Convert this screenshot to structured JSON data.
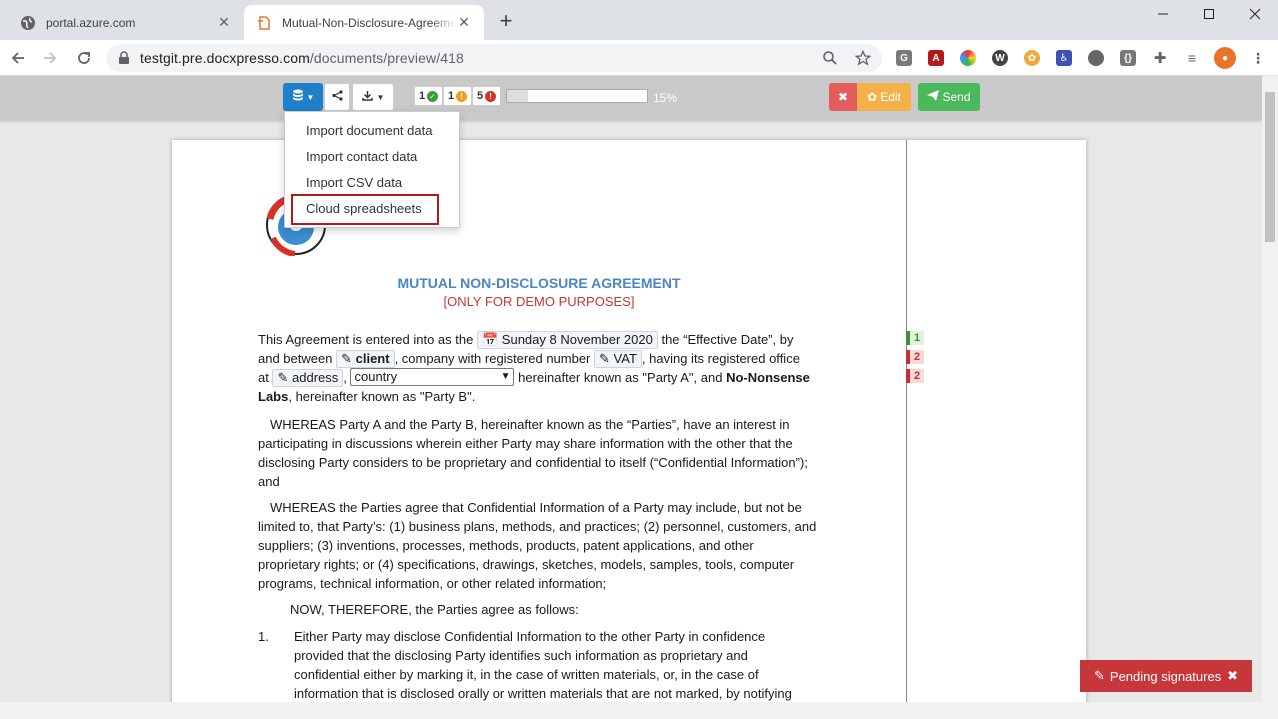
{
  "browser": {
    "tabs": [
      {
        "title": "portal.azure.com",
        "active": false
      },
      {
        "title": "Mutual-Non-Disclosure-Agreeme",
        "active": true
      }
    ],
    "url_host": "testgit.pre.docxpresso.com",
    "url_path": "/documents/preview/418",
    "new_tab": "+"
  },
  "appbar": {
    "counters": [
      {
        "value": "1",
        "color": "#3a9a3a",
        "icon": "check-icon"
      },
      {
        "value": "1",
        "color": "#f0a020",
        "icon": "warning-icon"
      },
      {
        "value": "5",
        "color": "#d9302c",
        "icon": "error-icon"
      }
    ],
    "progress_fraction": 0.15,
    "progress_label": "15%",
    "edit_label": "Edit",
    "send_label": "Send"
  },
  "dropdown": {
    "items": [
      "Import document data",
      "Import contact data",
      "Import CSV data",
      "Cloud spreadsheets"
    ]
  },
  "document": {
    "title": "MUTUAL NON-DISCLOSURE AGREEMENT",
    "subtitle": "[ONLY FOR DEMO PURPOSES]",
    "p1_a": "This Agreement is entered into as the",
    "date_chip": "Sunday 8 November 2020",
    "p1_b": "the “Effective Date”, by",
    "p1_c": "and between",
    "client_chip": "client",
    "p1_d": ", company with registered number",
    "vat_chip": "VAT",
    "p1_e": ", having its registered office",
    "p1_f": "at",
    "address_chip": "address",
    "country_select": "country",
    "p1_g": "hereinafter known as \"Party A\", and",
    "party_b_name": "No-Nonsense Labs",
    "p1_h": ", hereinafter known as \"Party B\".",
    "p2": "WHEREAS Party A and the Party B, hereinafter known as the “Parties”, have an interest in participating in discussions wherein either Party may share information with the other that the disclosing Party considers to be proprietary and confidential to itself (“Confidential Information”); and",
    "p3": "WHEREAS the Parties agree that Confidential Information of a Party may include, but not be limited to, that Party’s: (1) business plans, methods, and practices; (2) personnel, customers, and suppliers; (3) inventions, processes, methods, products, patent applications, and other proprietary rights; or (4) specifications, drawings, sketches, models, samples, tools, computer programs, technical information, or other related information;",
    "p4": "NOW, THEREFORE, the Parties agree as follows:",
    "item1_num": "1.",
    "item1": "Either Party may disclose Confidential Information to the other Party in confidence provided that the disclosing Party identifies such information as proprietary and confidential either by marking it, in the case of written materials, or, in the case of information that is disclosed orally or written materials that are not marked, by notifying"
  },
  "markers": [
    "1",
    "2",
    "2"
  ],
  "pending": {
    "label": "Pending signatures"
  }
}
